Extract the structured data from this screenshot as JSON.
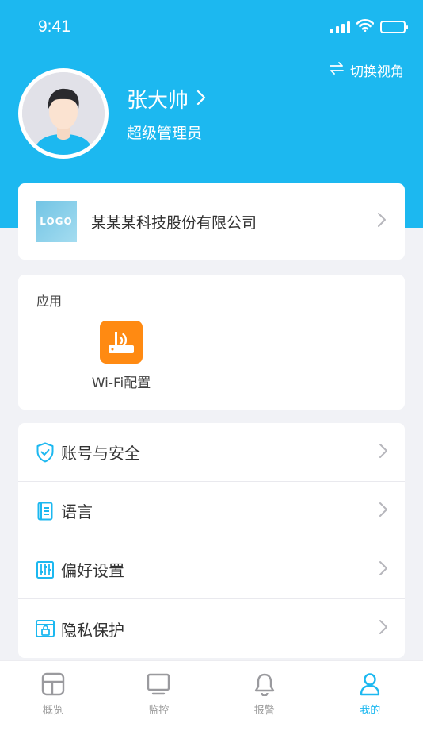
{
  "status_bar": {
    "time": "9:41"
  },
  "header": {
    "switch_view_label": "切换视角",
    "user_name": "张大帅",
    "user_role": "超级管理员"
  },
  "company": {
    "logo_text": "LOGO",
    "name": "某某某科技股份有限公司"
  },
  "apps": {
    "title": "应用",
    "items": [
      {
        "label": "Wi-Fi配置",
        "icon": "wifi-router-icon"
      }
    ]
  },
  "menu": {
    "items": [
      {
        "label": "账号与安全",
        "icon": "shield-icon"
      },
      {
        "label": "语言",
        "icon": "book-icon"
      },
      {
        "label": "偏好设置",
        "icon": "sliders-icon"
      },
      {
        "label": "隐私保护",
        "icon": "privacy-lock-icon"
      }
    ]
  },
  "tabbar": {
    "items": [
      {
        "label": "概览",
        "icon": "overview-icon",
        "active": false
      },
      {
        "label": "监控",
        "icon": "monitor-icon",
        "active": false
      },
      {
        "label": "报警",
        "icon": "bell-icon",
        "active": false
      },
      {
        "label": "我的",
        "icon": "person-icon",
        "active": true
      }
    ]
  },
  "colors": {
    "accent": "#1cb8f0",
    "app_orange": "#ff8a12",
    "page_bg": "#f1f2f6"
  }
}
